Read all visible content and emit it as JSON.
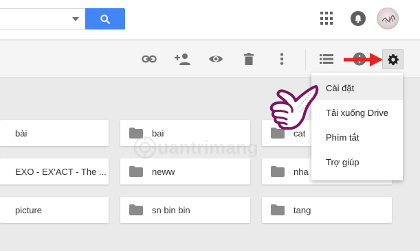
{
  "search": {
    "placeholder": ""
  },
  "folders": [
    {
      "name": "bài"
    },
    {
      "name": "bai"
    },
    {
      "name": "cat"
    },
    {
      "name": "EXO - EX'ACT - The ..."
    },
    {
      "name": "neww"
    },
    {
      "name": "nha"
    },
    {
      "name": "picture"
    },
    {
      "name": "sn bin bin"
    },
    {
      "name": "tang"
    }
  ],
  "settings_menu": {
    "items": [
      {
        "label": "Cài đặt"
      },
      {
        "label": "Tải xuống Drive"
      },
      {
        "label": "Phím tắt"
      },
      {
        "label": "Trợ giúp"
      }
    ]
  },
  "watermark": {
    "text": "uantrimang"
  },
  "colors": {
    "search_button": "#4285f4",
    "annotation_arrow": "#e82323",
    "hand_outline": "#7b1560"
  },
  "icons": [
    "chevron-down-icon",
    "search-icon",
    "apps-grid-icon",
    "notifications-icon",
    "link-icon",
    "add-person-icon",
    "preview-eye-icon",
    "trash-icon",
    "more-vert-icon",
    "list-view-icon",
    "info-icon",
    "settings-gear-icon",
    "folder-icon"
  ]
}
